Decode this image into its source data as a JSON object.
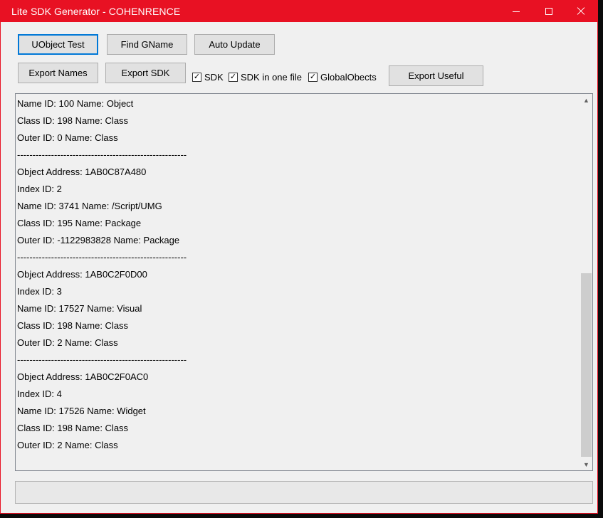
{
  "window": {
    "title": "Lite SDK Generator - COHENRENCE"
  },
  "buttons": {
    "uobject_test": "UObject Test",
    "find_gname": "Find GName",
    "auto_update": "Auto Update",
    "export_names": "Export Names",
    "export_sdk": "Export SDK",
    "export_useful": "Export Useful"
  },
  "checkboxes": {
    "sdk": {
      "label": "SDK",
      "checked": true
    },
    "sdk_one_file": {
      "label": "SDK in one file",
      "checked": true
    },
    "global_objects": {
      "label": "GlobalObects",
      "checked": true
    }
  },
  "log": {
    "lines": [
      "Name ID: 100 Name: Object",
      "Class ID: 198 Name: Class",
      "Outer ID: 0 Name: Class",
      "-------------------------------------------------------",
      "Object Address: 1AB0C87A480",
      "Index ID: 2",
      "Name ID: 3741 Name: /Script/UMG",
      "Class ID: 195 Name: Package",
      "Outer ID: -1122983828 Name: Package",
      "-------------------------------------------------------",
      "Object Address: 1AB0C2F0D00",
      "Index ID: 3",
      "Name ID: 17527 Name: Visual",
      "Class ID: 198 Name: Class",
      "Outer ID: 2 Name: Class",
      "-------------------------------------------------------",
      "Object Address: 1AB0C2F0AC0",
      "Index ID: 4",
      "Name ID: 17526 Name: Widget",
      "Class ID: 198 Name: Class",
      "Outer ID: 2 Name: Class"
    ]
  },
  "status": {
    "text": ""
  },
  "icons": {
    "minimize": "minimize-icon",
    "maximize": "maximize-icon",
    "close": "close-icon",
    "checkmark": "checkmark-icon",
    "scroll_up": "chevron-up-icon",
    "scroll_down": "chevron-down-icon"
  },
  "colors": {
    "titlebar": "#e81123",
    "window_bg": "#f0f0f0",
    "focus_border": "#0078d7"
  }
}
